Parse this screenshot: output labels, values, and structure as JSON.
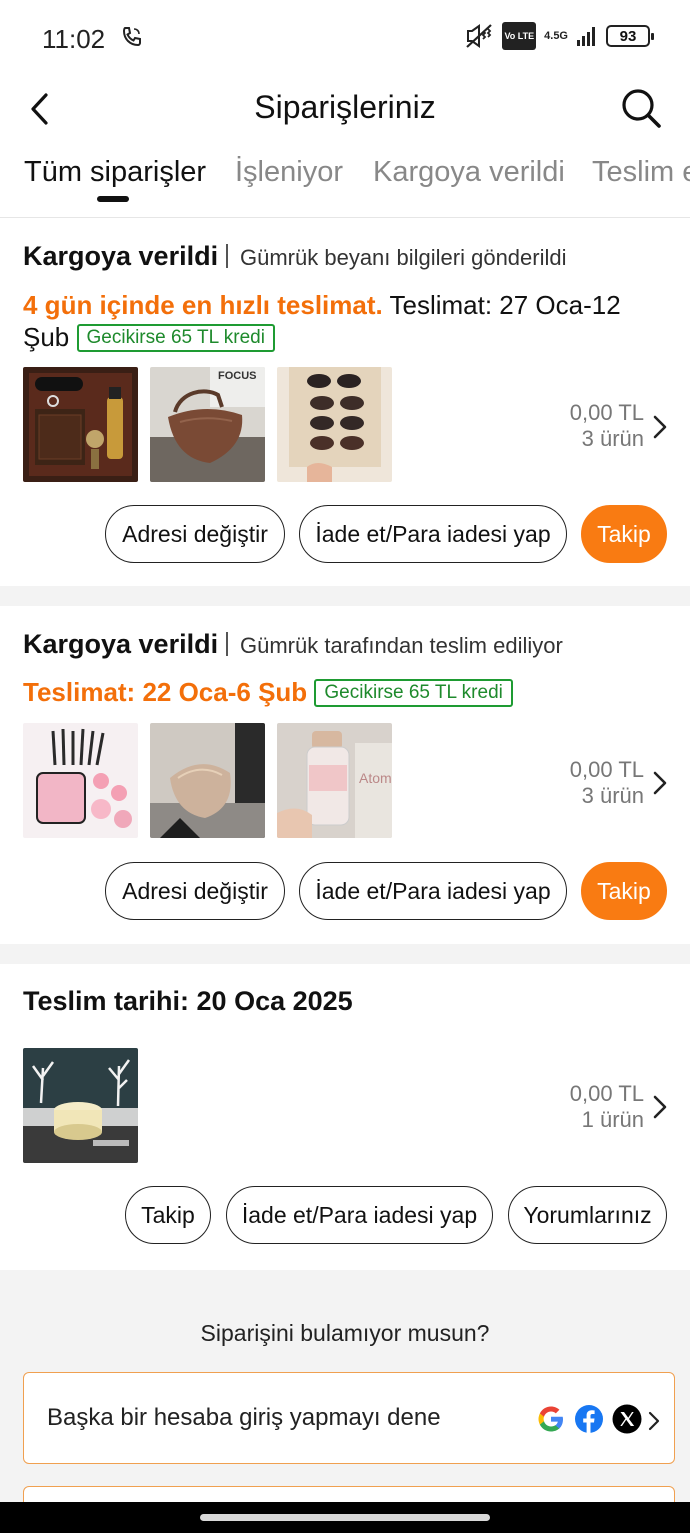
{
  "status_bar": {
    "time": "11:02",
    "network": "4.5G",
    "volte": "Vo LTE",
    "battery": "93"
  },
  "header": {
    "title": "Siparişleriniz"
  },
  "tabs": [
    {
      "label": "Tüm siparişler",
      "active": true
    },
    {
      "label": "İşleniyor",
      "active": false
    },
    {
      "label": "Kargoya verildi",
      "active": false
    },
    {
      "label": "Teslim e",
      "active": false
    }
  ],
  "orders": [
    {
      "status": "Kargoya verildi",
      "substatus": "Gümrük beyanı bilgileri gönderildi",
      "fast_delivery": "4 gün içinde en hızlı teslimat.",
      "delivery_text": " Teslimat: 27 Oca-12 Şub",
      "late_credit": "Gecikirse 65 TL kredi",
      "price": "0,00 TL",
      "item_count": "3 ürün",
      "buttons": [
        "Adresi değiştir",
        "İade et/Para iadesi yap",
        "Takip"
      ]
    },
    {
      "status": "Kargoya verildi",
      "substatus": "Gümrük tarafından teslim ediliyor",
      "delivery_text": "Teslimat: 22 Oca-6 Şub",
      "late_credit": "Gecikirse 65 TL kredi",
      "price": "0,00 TL",
      "item_count": "3 ürün",
      "buttons": [
        "Adresi değiştir",
        "İade et/Para iadesi yap",
        "Takip"
      ]
    },
    {
      "status": "Teslim tarihi: 20 Oca 2025",
      "price": "0,00 TL",
      "item_count": "1 ürün",
      "buttons": [
        "Takip",
        "İade et/Para iadesi yap",
        "Yorumlarınız"
      ]
    }
  ],
  "footer": {
    "not_found": "Siparişini bulamıyor musun?",
    "login_other": "Başka bir hesaba giriş yapmayı dene"
  },
  "colors": {
    "accent_orange": "#f97b12",
    "green_badge": "#1e9b32"
  }
}
